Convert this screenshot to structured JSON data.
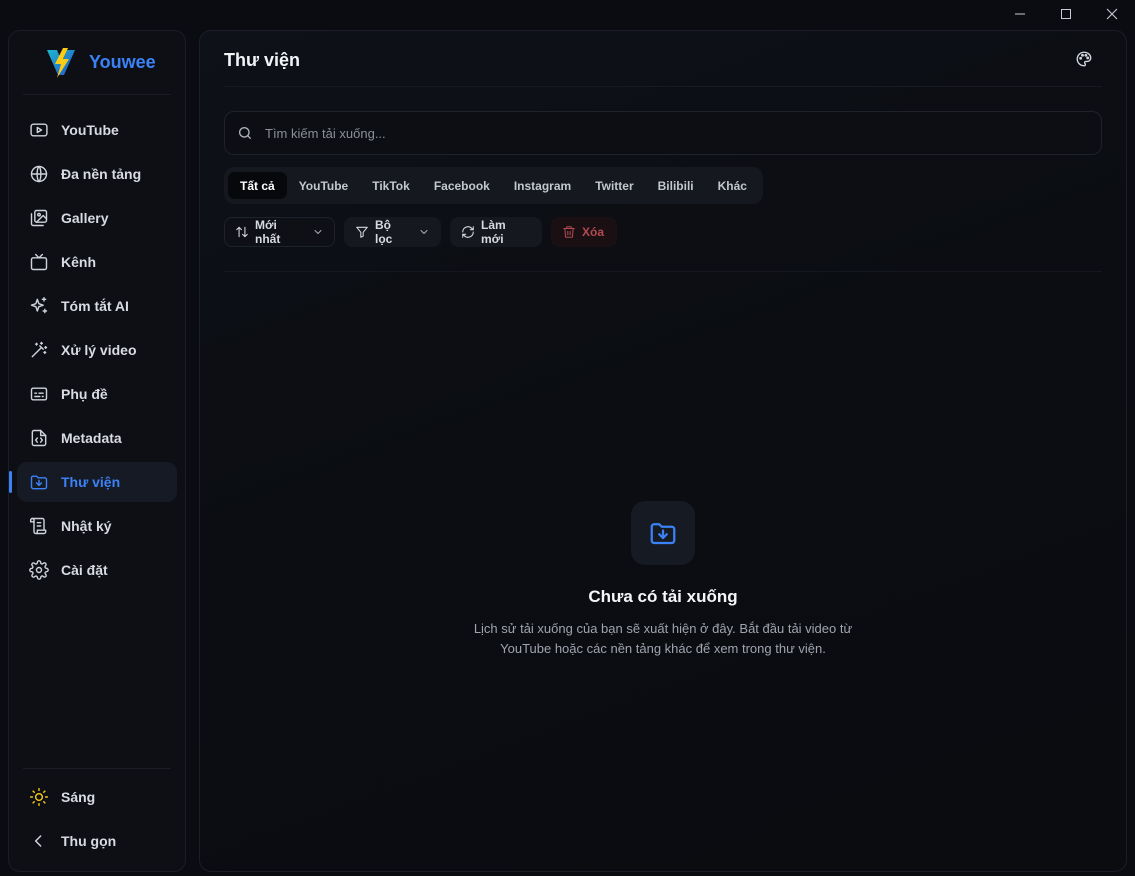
{
  "brand": {
    "name": "Youwee"
  },
  "sidebar": {
    "items": [
      {
        "label": "YouTube",
        "icon": "youtube-icon"
      },
      {
        "label": "Đa nền tảng",
        "icon": "globe-icon"
      },
      {
        "label": "Gallery",
        "icon": "gallery-icon"
      },
      {
        "label": "Kênh",
        "icon": "tv-icon"
      },
      {
        "label": "Tóm tắt AI",
        "icon": "sparkles-icon"
      },
      {
        "label": "Xử lý video",
        "icon": "magic-wand-icon"
      },
      {
        "label": "Phụ đề",
        "icon": "subtitles-icon"
      },
      {
        "label": "Metadata",
        "icon": "code-file-icon"
      },
      {
        "label": "Thư viện",
        "icon": "folder-download-icon",
        "active": true
      },
      {
        "label": "Nhật ký",
        "icon": "scroll-icon"
      },
      {
        "label": "Cài đặt",
        "icon": "gear-icon"
      }
    ],
    "bottom": {
      "theme_label": "Sáng",
      "collapse_label": "Thu gọn"
    }
  },
  "main": {
    "title": "Thư viện",
    "search": {
      "placeholder": "Tìm kiếm tải xuống..."
    },
    "tabs": [
      "Tất cả",
      "YouTube",
      "TikTok",
      "Facebook",
      "Instagram",
      "Twitter",
      "Bilibili",
      "Khác"
    ],
    "actions": {
      "sort_label": "Mới nhất",
      "filter_label": "Bộ lọc",
      "refresh_label": "Làm mới",
      "delete_label": "Xóa"
    },
    "empty": {
      "title": "Chưa có tải xuống",
      "description": "Lịch sử tải xuống của bạn sẽ xuất hiện ở đây. Bắt đầu tải video từ YouTube hoặc các nền tảng khác để xem trong thư viện."
    }
  },
  "colors": {
    "accent": "#3b82f6",
    "danger": "#b24a4f",
    "background": "#0a0c11"
  }
}
